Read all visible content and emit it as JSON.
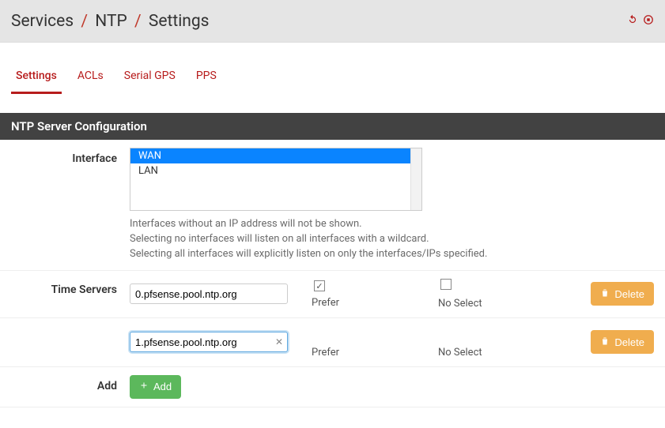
{
  "breadcrumb": {
    "a": "Services",
    "b": "NTP",
    "c": "Settings"
  },
  "tabs": {
    "settings": "Settings",
    "acls": "ACLs",
    "serial": "Serial GPS",
    "pps": "PPS"
  },
  "panel": {
    "title": "NTP Server Configuration"
  },
  "iface": {
    "label": "Interface",
    "items": [
      "WAN",
      "LAN"
    ],
    "selected": "WAN",
    "help1": "Interfaces without an IP address will not be shown.",
    "help2": "Selecting no interfaces will listen on all interfaces with a wildcard.",
    "help3": "Selecting all interfaces will explicitly listen on only the interfaces/IPs specified."
  },
  "ts": {
    "label": "Time Servers",
    "prefer": "Prefer",
    "noselect": "No Select",
    "delete": "Delete",
    "rows": [
      {
        "host": "0.pfsense.pool.ntp.org",
        "prefer": true,
        "noselect": false,
        "focused": false
      },
      {
        "host": "1.pfsense.pool.ntp.org",
        "prefer": false,
        "noselect": false,
        "focused": true
      }
    ]
  },
  "add": {
    "label": "Add",
    "btn": "Add"
  }
}
